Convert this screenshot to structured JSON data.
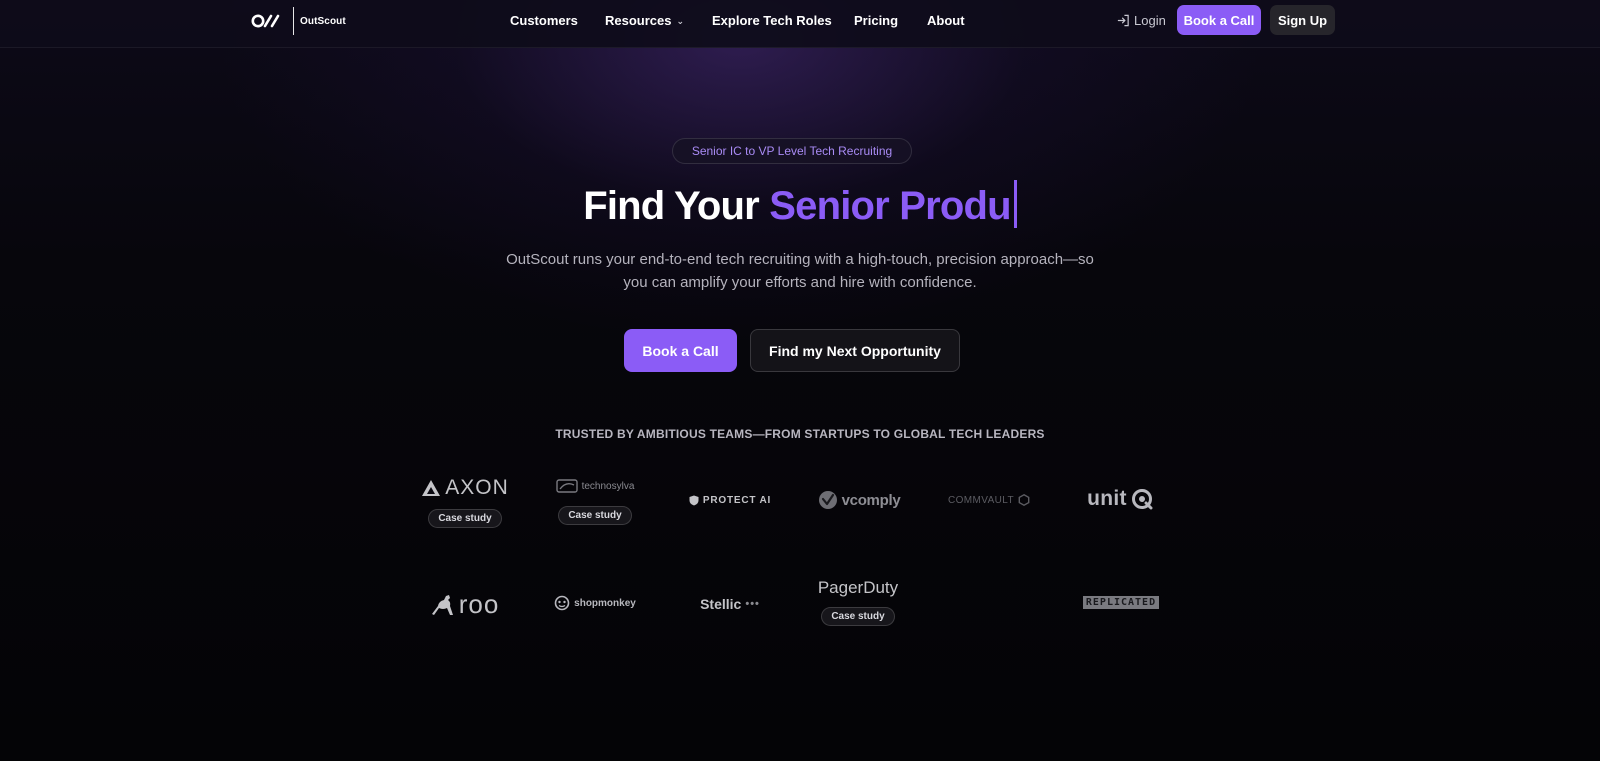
{
  "brand": {
    "name": "OutScout",
    "logo_icon": "outscout-logo-icon"
  },
  "nav": {
    "links": [
      {
        "label": "Customers"
      },
      {
        "label": "Resources",
        "has_dropdown": true
      },
      {
        "label": "Explore Tech Roles"
      },
      {
        "label": "Pricing"
      },
      {
        "label": "About"
      }
    ],
    "login": "Login",
    "book_call": "Book a Call",
    "sign_up": "Sign Up"
  },
  "hero": {
    "eyebrow": "Senior IC to VP Level Tech Recruiting",
    "headline_prefix": "Find Your",
    "headline_typed": "Senior Produ",
    "subtext": "OutScout runs your end-to-end tech recruiting with a high-touch, precision approach—so you can amplify your efforts and hire with confidence.",
    "primary_cta": "Book a Call",
    "secondary_cta": "Find my Next Opportunity"
  },
  "trusted": {
    "heading": "TRUSTED BY AMBITIOUS TEAMS—FROM STARTUPS TO GLOBAL TECH LEADERS",
    "case_label": "Case study",
    "logos": [
      {
        "name": "AXON",
        "case_study": true
      },
      {
        "name": "technosylva",
        "case_study": true
      },
      {
        "name": "PROTECT AI",
        "case_study": false
      },
      {
        "name": "vcomply",
        "case_study": false
      },
      {
        "name": "COMMVAULT",
        "case_study": false
      },
      {
        "name": "unit",
        "case_study": false
      },
      {
        "name": "roo",
        "case_study": false
      },
      {
        "name": "shopmonkey",
        "case_study": false
      },
      {
        "name": "Stellic",
        "case_study": false
      },
      {
        "name": "PagerDuty",
        "case_study": true
      },
      {
        "name": "REPLICATED",
        "case_study": false
      }
    ]
  },
  "colors": {
    "accent": "#8b5cf6",
    "background": "#050408"
  }
}
